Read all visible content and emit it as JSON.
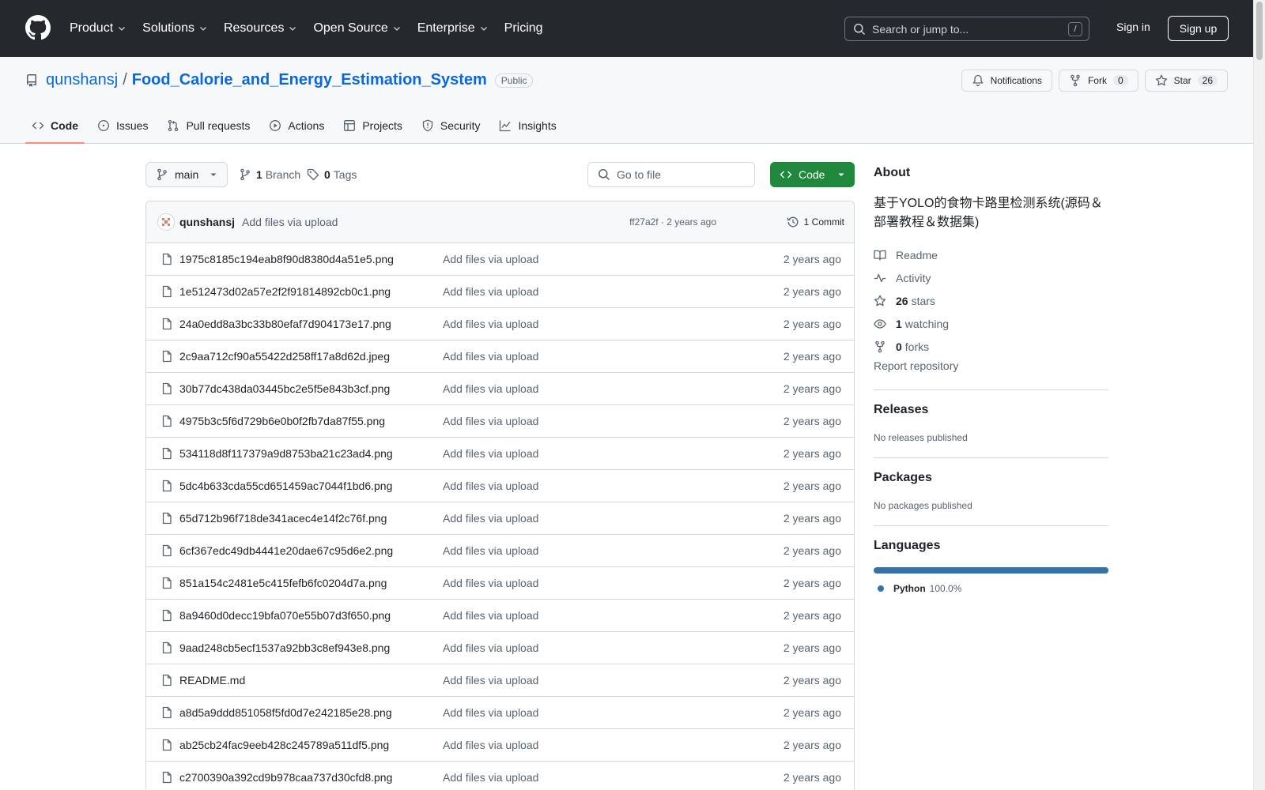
{
  "header": {
    "nav": [
      {
        "label": "Product",
        "dropdown": true
      },
      {
        "label": "Solutions",
        "dropdown": true
      },
      {
        "label": "Resources",
        "dropdown": true
      },
      {
        "label": "Open Source",
        "dropdown": true
      },
      {
        "label": "Enterprise",
        "dropdown": true
      },
      {
        "label": "Pricing",
        "dropdown": false
      }
    ],
    "search_placeholder": "Search or jump to...",
    "search_shortcut": "/",
    "sign_in": "Sign in",
    "sign_up": "Sign up"
  },
  "repo": {
    "owner": "qunshansj",
    "separator": "/",
    "name": "Food_Calorie_and_Energy_Estimation_System",
    "visibility": "Public",
    "notifications_label": "Notifications",
    "fork_label": "Fork",
    "fork_count": "0",
    "star_label": "Star",
    "star_count": "26",
    "tabs": [
      {
        "label": "Code",
        "icon": "code-icon",
        "active": true
      },
      {
        "label": "Issues",
        "icon": "issue-icon",
        "active": false
      },
      {
        "label": "Pull requests",
        "icon": "pull-request-icon",
        "active": false
      },
      {
        "label": "Actions",
        "icon": "play-icon",
        "active": false
      },
      {
        "label": "Projects",
        "icon": "table-icon",
        "active": false
      },
      {
        "label": "Security",
        "icon": "shield-icon",
        "active": false
      },
      {
        "label": "Insights",
        "icon": "graph-icon",
        "active": false
      }
    ]
  },
  "toolbar": {
    "branch": "main",
    "branch_count": "1",
    "branch_label": "Branch",
    "tag_count": "0",
    "tag_label": "Tags",
    "goto_placeholder": "Go to file",
    "code_label": "Code"
  },
  "commit": {
    "author": "qunshansj",
    "message": "Add files via upload",
    "meta": "ff27a2f · 2 years ago",
    "count_label": "1 Commit"
  },
  "files": [
    {
      "name": "1975c8185c194eab8f90d8380d4a51e5.png",
      "message": "Add files via upload",
      "age": "2 years ago"
    },
    {
      "name": "1e512473d02a57e2f2f91814892cb0c1.png",
      "message": "Add files via upload",
      "age": "2 years ago"
    },
    {
      "name": "24a0edd8a3bc33b80efaf7d904173e17.png",
      "message": "Add files via upload",
      "age": "2 years ago"
    },
    {
      "name": "2c9aa712cf90a55422d258ff17a8d62d.jpeg",
      "message": "Add files via upload",
      "age": "2 years ago"
    },
    {
      "name": "30b77dc438da03445bc2e5f5e843b3cf.png",
      "message": "Add files via upload",
      "age": "2 years ago"
    },
    {
      "name": "4975b3c5f6d729b6e0b0f2fb7da87f55.png",
      "message": "Add files via upload",
      "age": "2 years ago"
    },
    {
      "name": "534118d8f117379a9d8753ba21c23ad4.png",
      "message": "Add files via upload",
      "age": "2 years ago"
    },
    {
      "name": "5dc4b633cda55cd651459ac7044f1bd6.png",
      "message": "Add files via upload",
      "age": "2 years ago"
    },
    {
      "name": "65d712b96f718de341acec4e14f2c76f.png",
      "message": "Add files via upload",
      "age": "2 years ago"
    },
    {
      "name": "6cf367edc49db4441e20dae67c95d6e2.png",
      "message": "Add files via upload",
      "age": "2 years ago"
    },
    {
      "name": "851a154c2481e5c415fefb6fc0204d7a.png",
      "message": "Add files via upload",
      "age": "2 years ago"
    },
    {
      "name": "8a9460d0decc19bfa070e55b07d3f650.png",
      "message": "Add files via upload",
      "age": "2 years ago"
    },
    {
      "name": "9aad248cb5ecf1537a92bb3c8ef943e8.png",
      "message": "Add files via upload",
      "age": "2 years ago"
    },
    {
      "name": "README.md",
      "message": "Add files via upload",
      "age": "2 years ago"
    },
    {
      "name": "a8d5a9ddd851058f5fd0d7e242185e28.png",
      "message": "Add files via upload",
      "age": "2 years ago"
    },
    {
      "name": "ab25cb24fac9eeb428c245789a511df5.png",
      "message": "Add files via upload",
      "age": "2 years ago"
    },
    {
      "name": "c2700390a392cd9b978caa737d30cfd8.png",
      "message": "Add files via upload",
      "age": "2 years ago"
    }
  ],
  "about": {
    "heading": "About",
    "description": "基于YOLO的食物卡路里检测系统(源码＆部署教程＆数据集)",
    "readme": "Readme",
    "activity": "Activity",
    "stars_count": "26",
    "stars_label": "stars",
    "watching_count": "1",
    "watching_label": "watching",
    "forks_count": "0",
    "forks_label": "forks",
    "report": "Report repository"
  },
  "releases": {
    "heading": "Releases",
    "note": "No releases published"
  },
  "packages": {
    "heading": "Packages",
    "note": "No packages published"
  },
  "languages": {
    "heading": "Languages",
    "items": [
      {
        "name": "Python",
        "percent": "100.0%",
        "color": "#3572A5"
      }
    ]
  },
  "colors": {
    "header_bg": "#25292e",
    "link": "#0969da",
    "primary_button": "#1f883d",
    "active_tab_underline": "#fd8c73"
  }
}
